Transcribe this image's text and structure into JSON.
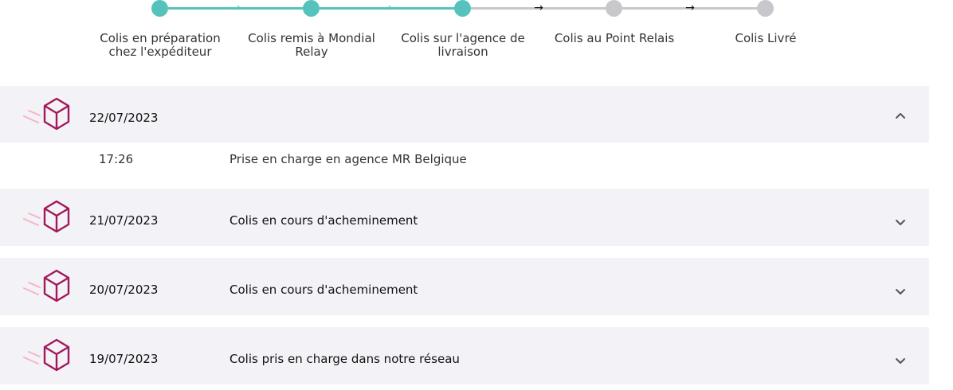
{
  "tracker": {
    "steps": [
      {
        "label": "Colis en préparation chez l'expéditeur",
        "done": true
      },
      {
        "label": "Colis remis à Mondial Relay",
        "done": true
      },
      {
        "label": "Colis sur l'agence de livraison",
        "done": true
      },
      {
        "label": "Colis au Point Relais",
        "done": false
      },
      {
        "label": "Colis Livré",
        "done": false
      }
    ]
  },
  "events": [
    {
      "date": "22/07/2023",
      "status": "",
      "expanded": true,
      "details": [
        {
          "time": "17:26",
          "description": "Prise en charge en agence MR Belgique"
        }
      ]
    },
    {
      "date": "21/07/2023",
      "status": "Colis en cours d'acheminement",
      "expanded": false
    },
    {
      "date": "20/07/2023",
      "status": "Colis en cours d'acheminement",
      "expanded": false
    },
    {
      "date": "19/07/2023",
      "status": "Colis pris en charge dans notre réseau",
      "expanded": false
    }
  ],
  "colors": {
    "done": "#55c3bb",
    "pending": "#c8c8cc",
    "panel_bg": "#f3f2f7",
    "icon": "#a3185a"
  },
  "icons": {
    "event": "parcel-box-icon",
    "expanded": "chevron-up-icon",
    "collapsed": "chevron-down-icon"
  }
}
